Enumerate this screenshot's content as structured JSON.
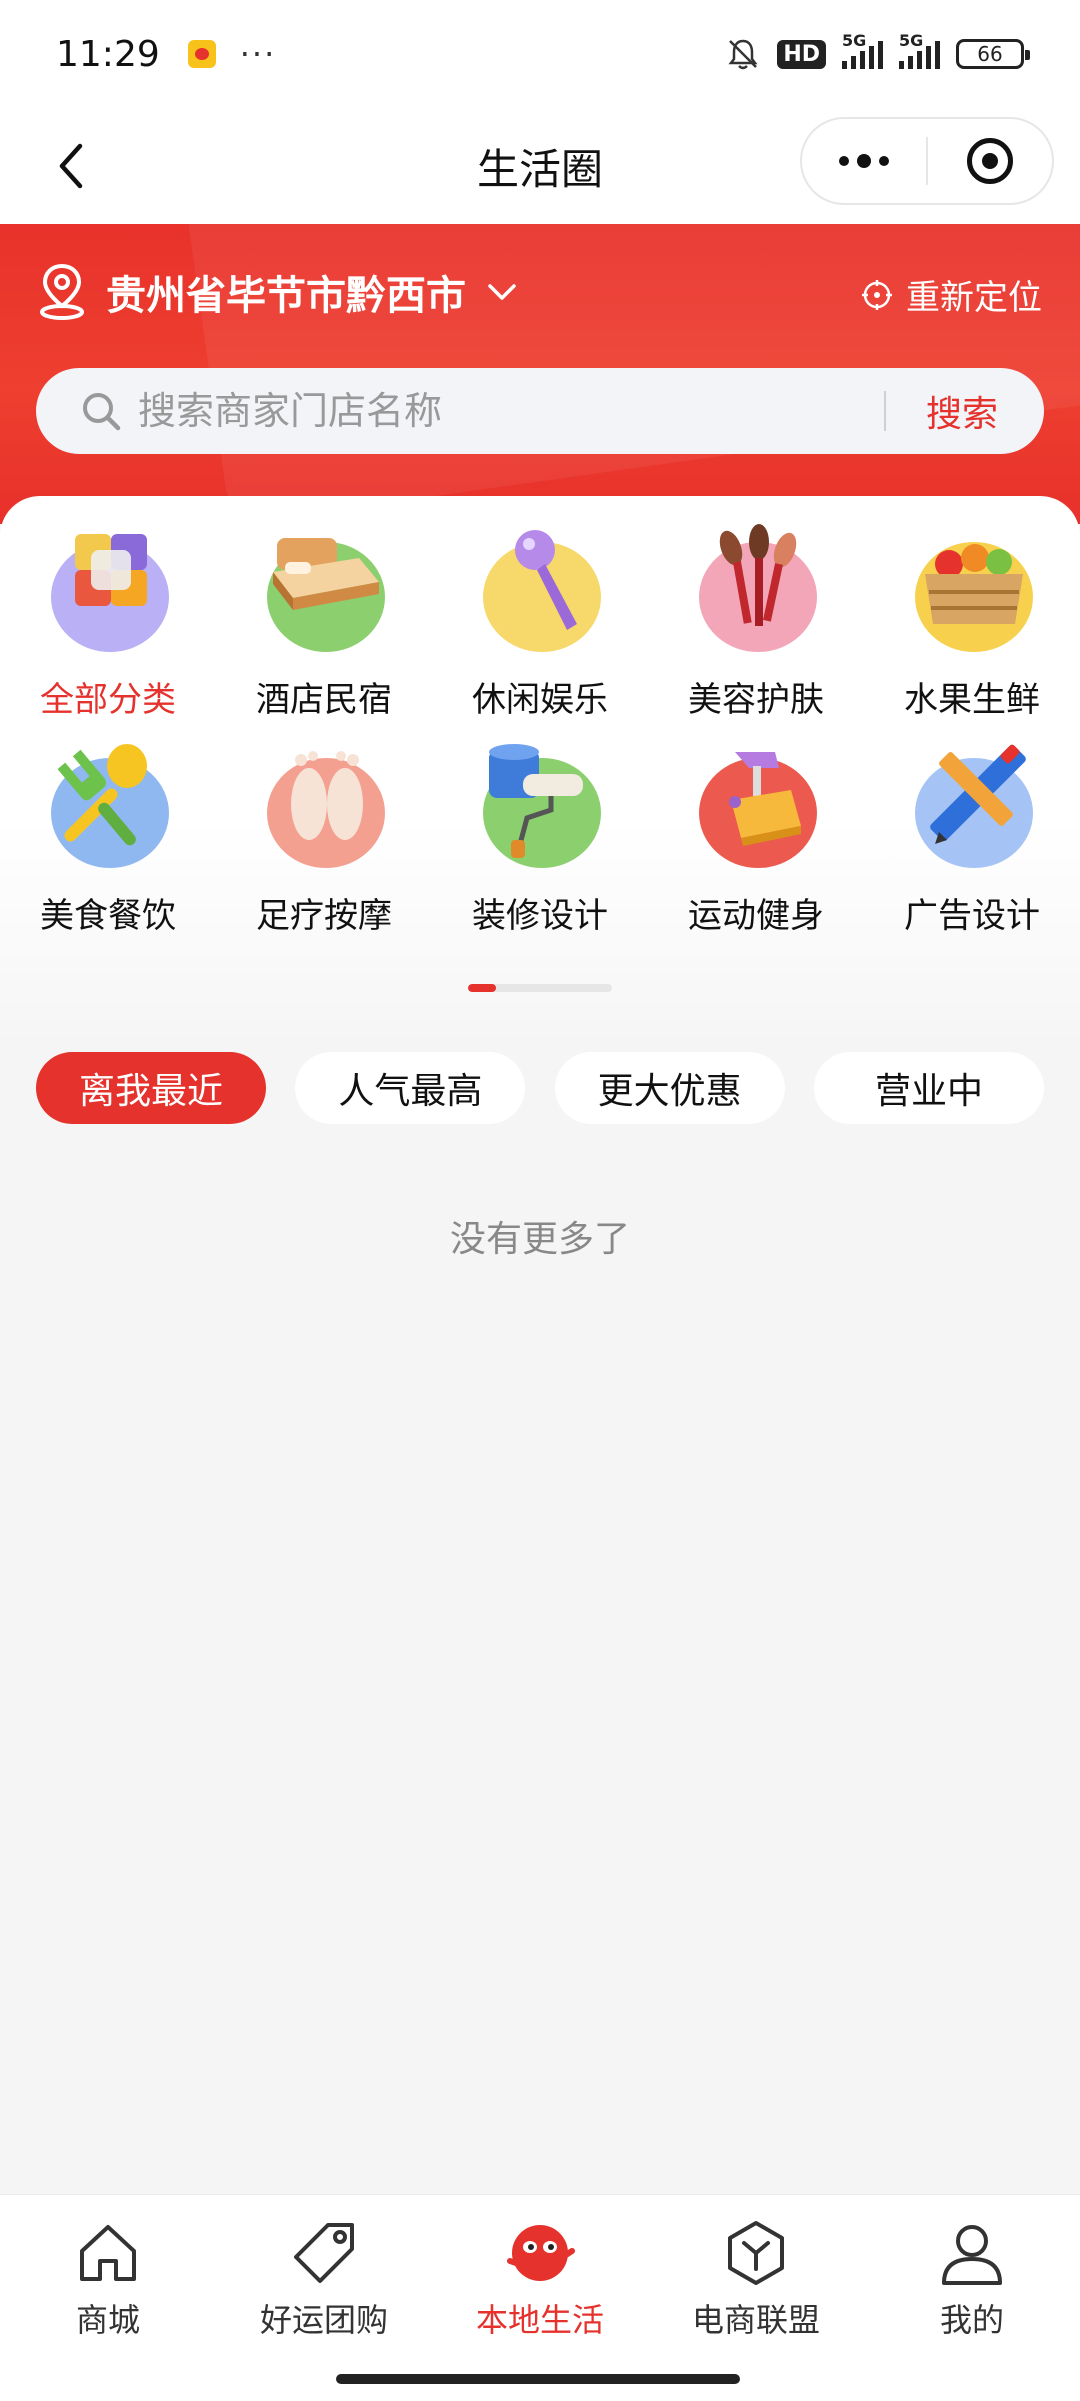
{
  "status_bar": {
    "time": "11:29",
    "dots": "···",
    "hd_label": "HD",
    "signal_1_label": "5G",
    "signal_2_label": "5G",
    "battery": "66"
  },
  "nav": {
    "title": "生活圈"
  },
  "header": {
    "location": "贵州省毕节市黔西市",
    "relocate_label": "重新定位",
    "search_placeholder": "搜索商家门店名称",
    "search_button": "搜索"
  },
  "categories": [
    {
      "label": "全部分类",
      "icon": "all-categories-cube-icon",
      "color": "#b9b0f5",
      "active": true
    },
    {
      "label": "酒店民宿",
      "icon": "hotel-bed-icon",
      "color": "#8ccf6e"
    },
    {
      "label": "休闲娱乐",
      "icon": "microphone-icon",
      "color": "#f7d96b"
    },
    {
      "label": "美容护肤",
      "icon": "makeup-brush-icon",
      "color": "#f4a6b9"
    },
    {
      "label": "水果生鲜",
      "icon": "fruit-crate-icon",
      "color": "#f7d14e"
    },
    {
      "label": "美食餐饮",
      "icon": "fork-spoon-icon",
      "color": "#8fb8f0"
    },
    {
      "label": "足疗按摩",
      "icon": "feet-icon",
      "color": "#f4a090"
    },
    {
      "label": "装修设计",
      "icon": "paint-roller-icon",
      "color": "#8ccf6e"
    },
    {
      "label": "运动健身",
      "icon": "fitness-gear-icon",
      "color": "#ec5a4f"
    },
    {
      "label": "广告设计",
      "icon": "ruler-pencil-icon",
      "color": "#a5c4f5"
    }
  ],
  "page_indicator": {
    "current": 1,
    "total": 5
  },
  "filters": [
    {
      "label": "离我最近",
      "active": true
    },
    {
      "label": "人气最高"
    },
    {
      "label": "更大优惠"
    },
    {
      "label": "营业中"
    }
  ],
  "empty_text": "没有更多了",
  "tabs": [
    {
      "label": "商城",
      "icon": "home-icon"
    },
    {
      "label": "好运团购",
      "icon": "tag-icon"
    },
    {
      "label": "本地生活",
      "icon": "local-life-mascot-icon",
      "active": true
    },
    {
      "label": "电商联盟",
      "icon": "hexagon-y-icon"
    },
    {
      "label": "我的",
      "icon": "user-icon"
    }
  ],
  "colors": {
    "accent": "#e5322d",
    "header_red": "#ee3f30"
  }
}
